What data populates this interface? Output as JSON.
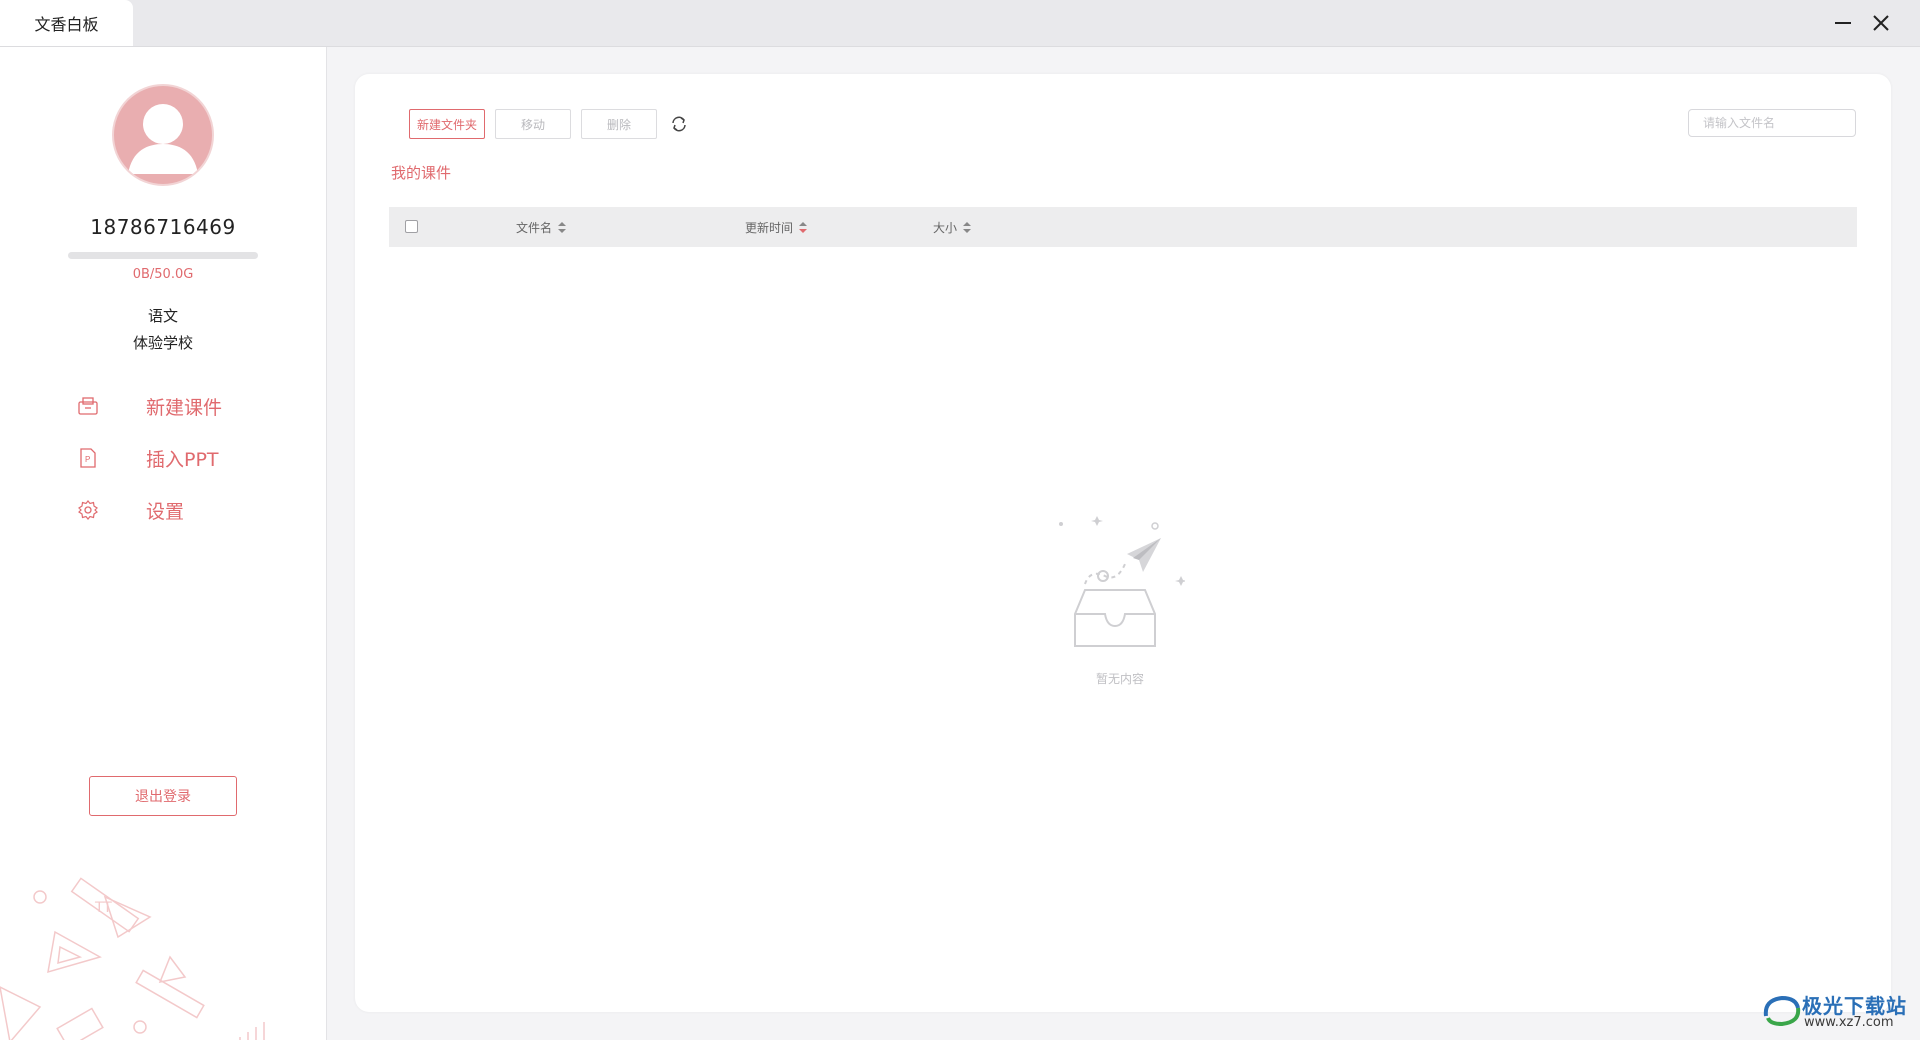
{
  "window": {
    "tab_title": "文香白板",
    "minimize_icon": "minimize-icon",
    "close_icon": "close-icon"
  },
  "sidebar": {
    "avatar_icon": "user-avatar-icon",
    "phone": "18786716469",
    "storage": {
      "text": "0B/50.0G",
      "used_fraction": 0.0
    },
    "subject": "语文",
    "school": "体验学校",
    "menu": [
      {
        "label": "新建课件",
        "icon": "new-courseware-icon"
      },
      {
        "label": "插入PPT",
        "icon": "ppt-file-icon"
      },
      {
        "label": "设置",
        "icon": "gear-icon"
      }
    ],
    "logout_label": "退出登录"
  },
  "toolbar": {
    "new_folder_label": "新建文件夹",
    "move_label": "移动",
    "delete_label": "删除",
    "refresh_icon": "refresh-icon",
    "search_placeholder": "请输入文件名"
  },
  "breadcrumb": "我的课件",
  "table": {
    "columns": [
      "文件名",
      "更新时间",
      "大小"
    ],
    "rows": []
  },
  "empty_state": {
    "text": "暂无内容",
    "icon": "empty-inbox-icon"
  },
  "watermark": {
    "title": "极光下载站",
    "url": "www.xz7.com"
  },
  "colors": {
    "accent": "#e06a6e",
    "avatar": "#e9aeb0"
  }
}
